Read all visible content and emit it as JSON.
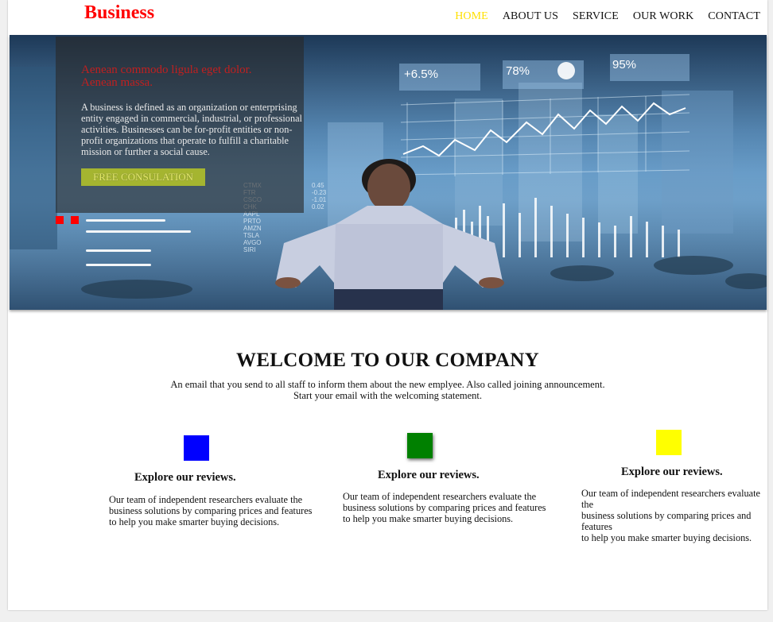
{
  "header": {
    "brand": "Business",
    "nav": [
      {
        "label": "HOME",
        "active": true
      },
      {
        "label": "ABOUT US",
        "active": false
      },
      {
        "label": "SERVICE",
        "active": false
      },
      {
        "label": "OUR WORK",
        "active": false
      },
      {
        "label": "CONTACT",
        "active": false
      }
    ],
    "active_color": "#ffe000"
  },
  "hero": {
    "title": "Aenean commodo ligula eget dolor. Aenean massa.",
    "text": "A business is defined as an organization or enterprising entity engaged in commercial, industrial, or professional activities. Businesses can be for-profit entities or non-profit organizations that operate to fulfill a charitable mission or further a social cause.",
    "button_label": "FREE CONSULATION",
    "stats": [
      "+6.5%",
      "78%",
      "95%"
    ]
  },
  "welcome": {
    "title": "WELCOME TO OUR COMPANY",
    "line1": "An email that you send to all staff to inform them about the new emplyee. Also called joining announcement.",
    "line2": "Start your email with the welcoming statement."
  },
  "features": [
    {
      "color": "#0000ff",
      "heading": "Explore our reviews.",
      "text": "Our team of independent researchers evaluate the business solutions by comparing prices and features to help you make smarter buying decisions."
    },
    {
      "color": "#008000",
      "heading": "Explore our reviews.",
      "text": "Our team of independent researchers evaluate the business solutions by comparing prices and features to help you make smarter buying decisions."
    },
    {
      "color": "#ffff00",
      "heading": "Explore our reviews.",
      "text_lines": [
        "Our team of independent researchers evaluate the",
        "business solutions by comparing prices and features",
        "to help you make smarter buying decisions."
      ]
    }
  ],
  "brand_color": "#ff0000"
}
